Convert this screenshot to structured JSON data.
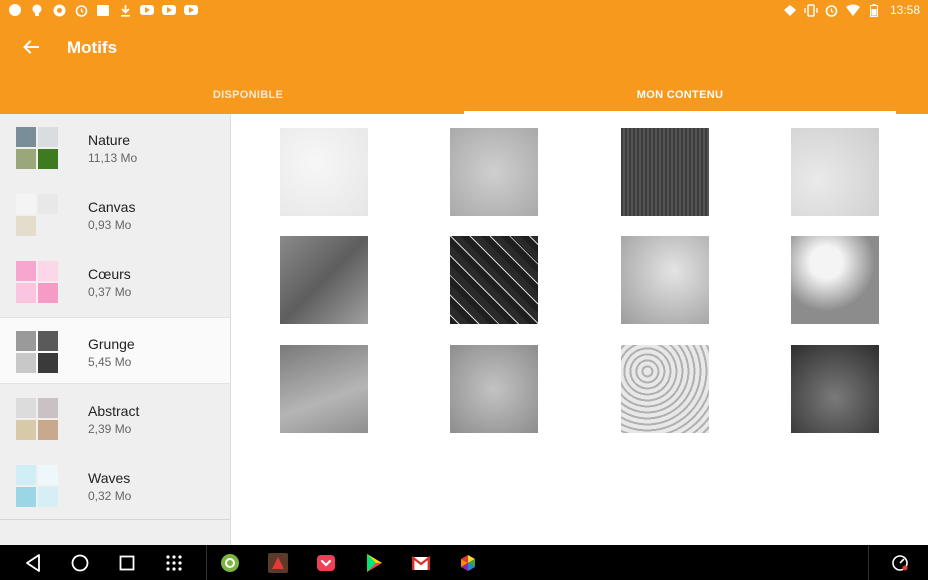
{
  "status_bar": {
    "time": "13:58",
    "left_icons": [
      "pinterest-icon",
      "lightbulb-icon",
      "chrome-icon",
      "alarm-icon",
      "image-icon",
      "download-icon",
      "youtube-icon",
      "youtube-icon",
      "youtube-icon"
    ],
    "right_icons": [
      "sync-icon",
      "vibrate-icon",
      "alarm-icon",
      "wifi-icon",
      "battery-icon"
    ]
  },
  "app_bar": {
    "title": "Motifs",
    "tabs": [
      {
        "label": "DISPONIBLE",
        "selected": false
      },
      {
        "label": "MON CONTENU",
        "selected": true
      }
    ]
  },
  "sidebar": {
    "items": [
      {
        "name": "Nature",
        "size": "11,13 Mo",
        "active": false
      },
      {
        "name": "Canvas",
        "size": "0,93 Mo",
        "active": false
      },
      {
        "name": "Cœurs",
        "size": "0,37 Mo",
        "active": false
      },
      {
        "name": "Grunge",
        "size": "5,45 Mo",
        "active": true
      },
      {
        "name": "Abstract",
        "size": "2,39 Mo",
        "active": false
      },
      {
        "name": "Waves",
        "size": "0,32 Mo",
        "active": false
      }
    ]
  },
  "grid": {
    "tiles": [
      "light-grunge-texture",
      "grey-grunge-texture",
      "dark-fabric-texture",
      "light-stone-texture",
      "scratched-grey-texture",
      "cracked-dark-texture",
      "peeling-paint-texture",
      "peeling-plaster-texture",
      "stained-wall-texture",
      "cloudy-grey-texture",
      "cracked-mud-texture",
      "dark-speckled-texture"
    ]
  },
  "nav_bar": {
    "buttons": [
      "back-icon",
      "home-icon",
      "recents-icon",
      "apps-grid-icon"
    ],
    "apps": [
      "settings-app-icon",
      "game-app-icon",
      "pocket-app-icon",
      "play-store-icon",
      "gmail-icon",
      "color-app-icon"
    ],
    "tray": [
      "speed-meter-icon"
    ]
  },
  "colors": {
    "accent": "#f7991c",
    "sidebar_bg": "#efefef",
    "active_item_bg": "#fafafa"
  }
}
